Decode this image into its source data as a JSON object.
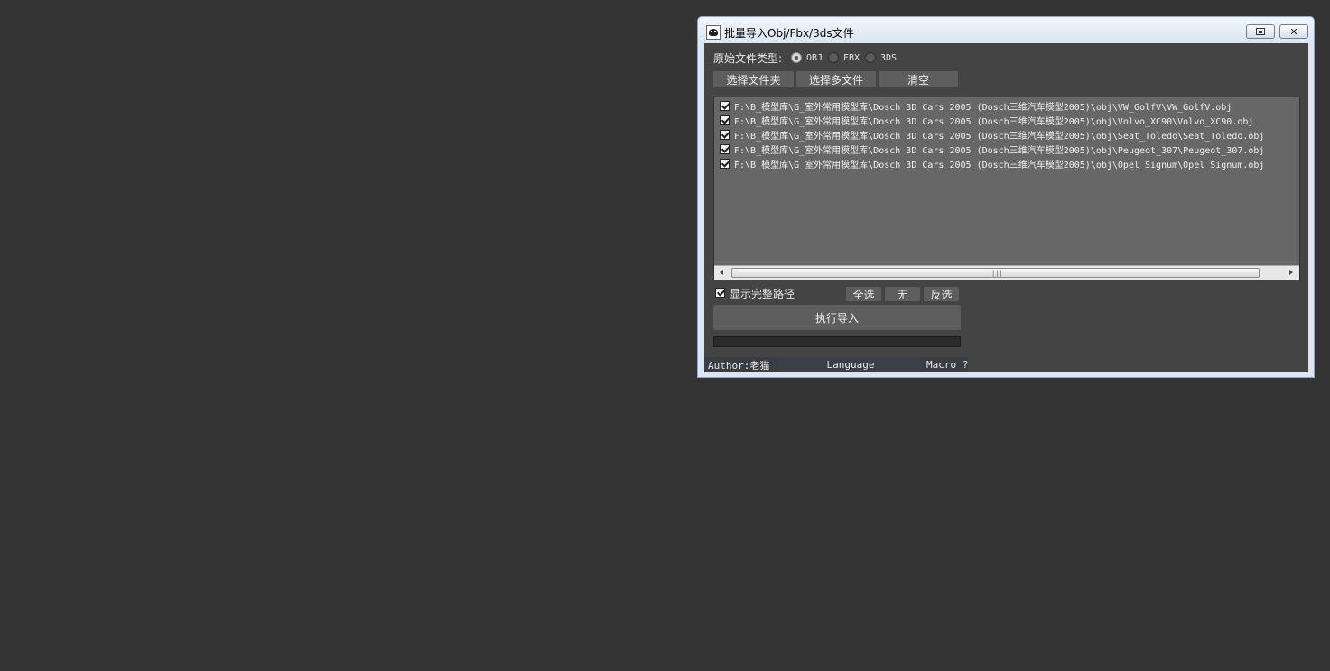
{
  "window": {
    "title": "批量导入Obj/Fbx/3ds文件"
  },
  "file_type": {
    "label": "原始文件类型:",
    "options": [
      {
        "label": "OBJ",
        "selected": true
      },
      {
        "label": "FBX",
        "selected": false
      },
      {
        "label": "3DS",
        "selected": false
      }
    ]
  },
  "toolbar": {
    "select_folder": "选择文件夹",
    "select_files": "选择多文件",
    "clear": "清空"
  },
  "files": [
    {
      "checked": true,
      "path": "F:\\B_模型库\\G_室外常用模型库\\Dosch 3D Cars 2005 (Dosch三维汽车模型2005)\\obj\\VW_GolfV\\VW_GolfV.obj"
    },
    {
      "checked": true,
      "path": "F:\\B_模型库\\G_室外常用模型库\\Dosch 3D Cars 2005 (Dosch三维汽车模型2005)\\obj\\Volvo_XC90\\Volvo_XC90.obj"
    },
    {
      "checked": true,
      "path": "F:\\B_模型库\\G_室外常用模型库\\Dosch 3D Cars 2005 (Dosch三维汽车模型2005)\\obj\\Seat_Toledo\\Seat_Toledo.obj"
    },
    {
      "checked": true,
      "path": "F:\\B_模型库\\G_室外常用模型库\\Dosch 3D Cars 2005 (Dosch三维汽车模型2005)\\obj\\Peugeot_307\\Peugeot_307.obj"
    },
    {
      "checked": true,
      "path": "F:\\B_模型库\\G_室外常用模型库\\Dosch 3D Cars 2005 (Dosch三维汽车模型2005)\\obj\\Opel_Signum\\Opel_Signum.obj"
    }
  ],
  "options": {
    "show_full_path": {
      "label": "显示完整路径",
      "checked": true
    },
    "select_all": "全选",
    "select_none": "无",
    "invert": "反选"
  },
  "actions": {
    "execute": "执行导入"
  },
  "progress": {
    "value": 0
  },
  "status": {
    "author": "Author:老猫",
    "language": "Language",
    "macro": "Macro ?"
  }
}
